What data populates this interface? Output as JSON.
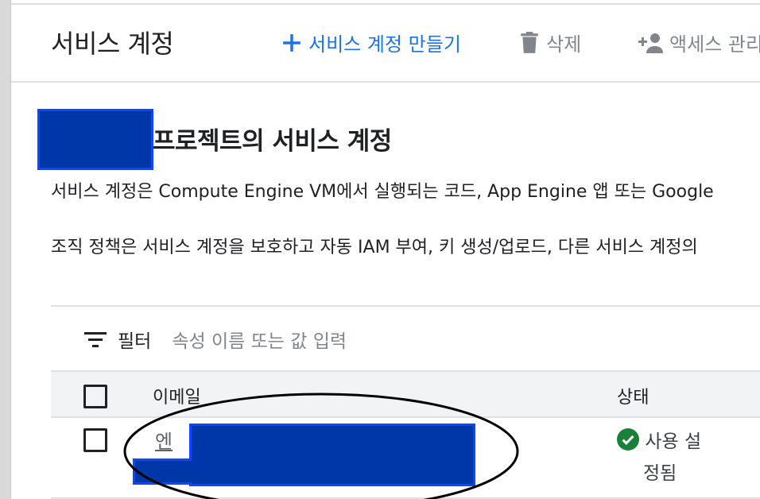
{
  "header": {
    "title": "서비스 계정",
    "actions": {
      "create_label": "서비스 계정 만들기",
      "delete_label": "삭제",
      "access_label": "액세스 관리"
    }
  },
  "section": {
    "title": "프로젝트의 서비스 계정",
    "description_1": "서비스 계정은 Compute Engine VM에서 실행되는 코드, App Engine 앱 또는 Google",
    "description_2": "조직 정책은 서비스 계정을 보호하고 자동 IAM 부여, 키 생성/업로드, 다른 서비스 계정의"
  },
  "filter": {
    "label": "필터",
    "placeholder": "속성 이름 또는 값 입력"
  },
  "table": {
    "columns": {
      "email": "이메일",
      "status": "상태"
    },
    "rows": [
      {
        "email_visible_prefix": "엔",
        "status_line_1": "사용 설",
        "status_line_2": "정됨"
      }
    ]
  },
  "colors": {
    "accent": "#1a73e8",
    "muted": "#80868b",
    "status_ok": "#188038",
    "redaction_fill": "#0037a8",
    "redaction_border": "#0a47ff"
  },
  "icons": {
    "create": "plus-icon",
    "delete": "trash-icon",
    "access": "add-person-icon",
    "filter": "filter-icon",
    "status": "check-circle-icon"
  }
}
